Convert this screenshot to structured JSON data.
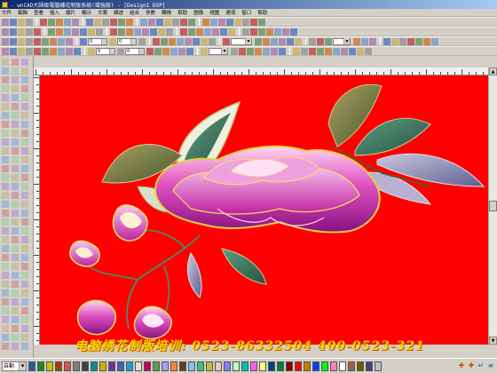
{
  "window": {
    "title": "- wnCAD大師級電腦繡花制版系統(增強版) - [Design1 DSP]"
  },
  "menu": {
    "items": [
      "文件",
      "編輯",
      "查看",
      "插入",
      "繡片",
      "顯示",
      "文案",
      "線迹",
      "組合",
      "參數",
      "轉換",
      "幫助",
      "圖像",
      "視圖",
      "選項",
      "窗口",
      "幫助"
    ]
  },
  "toolbar3": {
    "spin1": "0",
    "spin2": "0"
  },
  "toolbar4": {
    "spin1": "0",
    "spin2": "0"
  },
  "canvas": {
    "background_color": "#ff0000"
  },
  "training_banner": "电脑绣花制版培训: 0523-86332504  400-0523-321",
  "status": {
    "zoom_combo": "自動"
  },
  "palette": {
    "colors": [
      "#2a5aa0",
      "#1a8a1a",
      "#c8c800",
      "#a04000",
      "#e05050",
      "#808080",
      "#404040",
      "#009090",
      "#d8b000",
      "#7030a0",
      "#4060c0",
      "#20a0d0",
      "#e0e0e0",
      "#c00060",
      "#60a040",
      "#a0a0ff",
      "#ff8040",
      "#604020",
      "#80c0ff",
      "#40c080",
      "#c0c040",
      "#ffc0c0",
      "#8080ff",
      "#c0ffc0",
      "#00c0c0",
      "#ff60ff",
      "#ffff80",
      "#004080",
      "#008040",
      "#800000",
      "#ff0000",
      "#c08000",
      "#0040ff",
      "#00ff00",
      "#ff80c0",
      "#ffffff",
      "#a06040",
      "#606000",
      "#404080",
      "#c0c0c0"
    ]
  }
}
